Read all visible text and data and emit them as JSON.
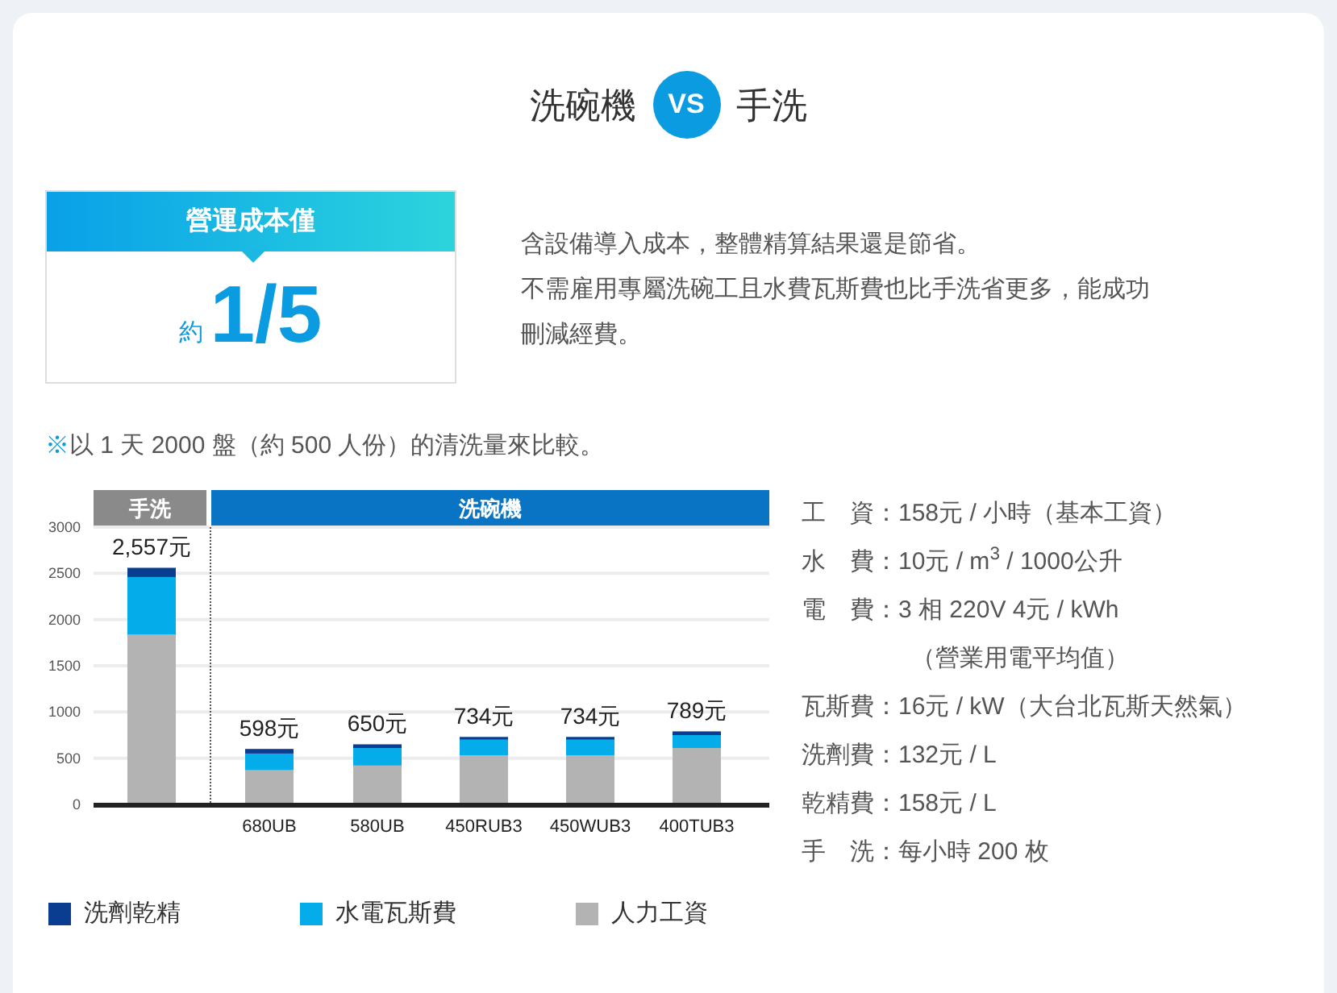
{
  "title": {
    "left": "洗碗機",
    "badge": "VS",
    "right": "手洗"
  },
  "cost_box": {
    "heading": "營運成本僅",
    "prefix": "約",
    "value": "1/5"
  },
  "description": [
    "含設備導入成本，整體精算結果還是節省。",
    "不需雇用專屬洗碗工且水費瓦斯費也比手洗省更多，能成功刪減經費。"
  ],
  "note": {
    "mark": "※",
    "text": "以 1 天 2000 盤（約 500 人份）的清洗量來比較。"
  },
  "chart": {
    "groups": [
      {
        "label": "手洗",
        "color": "#8a8a8a"
      },
      {
        "label": "洗碗機",
        "color": "#0a74c4"
      }
    ],
    "chart_data": {
      "type": "bar",
      "stacked": true,
      "categories": [
        null,
        "680UB",
        "580UB",
        "450RUB3",
        "450WUB3",
        "400TUB3"
      ],
      "series": [
        {
          "name": "人力工資",
          "color": "#b3b3b3",
          "values": [
            1840,
            370,
            420,
            530,
            530,
            610
          ]
        },
        {
          "name": "水電瓦斯費",
          "color": "#04adea",
          "values": [
            620,
            180,
            190,
            170,
            170,
            140
          ]
        },
        {
          "name": "洗劑乾精",
          "color": "#0a3d8f",
          "values": [
            100,
            50,
            40,
            30,
            30,
            40
          ]
        }
      ],
      "grid": true,
      "ylim": [
        0,
        3000
      ],
      "yticks": [
        0,
        500,
        1000,
        1500,
        2000,
        2500,
        3000
      ],
      "value_labels": [
        "2,557元",
        "598元",
        "650元",
        "734元",
        "734元",
        "789元"
      ]
    }
  },
  "costs": [
    {
      "kind": "line",
      "text": "工　資：158元 / 小時（基本工資）"
    },
    {
      "kind": "line",
      "text": "水　費：10元 / m$^{3}$ / 1000公升"
    },
    {
      "kind": "line",
      "text": "電　費：3 相 220V 4元 / kWh"
    },
    {
      "kind": "continuation",
      "text": "（營業用電平均值）"
    },
    {
      "kind": "line",
      "text": "瓦斯費：16元 / kW（大台北瓦斯天然氣）"
    },
    {
      "kind": "line",
      "text": "洗劑費：132元 / L"
    },
    {
      "kind": "line",
      "text": "乾精費：158元 / L"
    },
    {
      "kind": "line",
      "text": "手　洗：每小時 200 枚"
    }
  ]
}
